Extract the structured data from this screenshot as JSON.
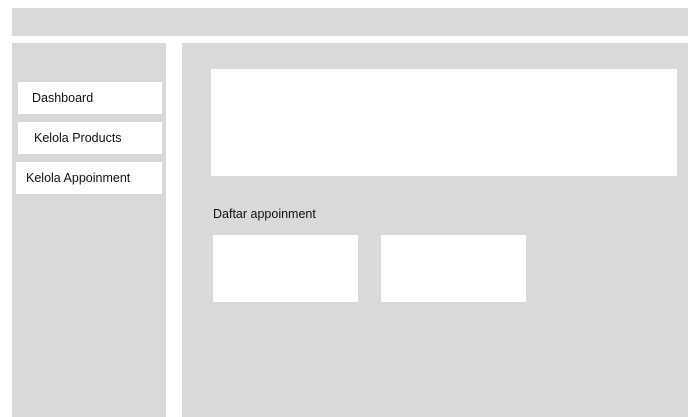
{
  "sidebar": {
    "items": [
      {
        "label": "Dashboard"
      },
      {
        "label": "Kelola Products"
      },
      {
        "label": "Kelola Appoinment"
      }
    ]
  },
  "main": {
    "section_title": "Daftar appoinment"
  }
}
